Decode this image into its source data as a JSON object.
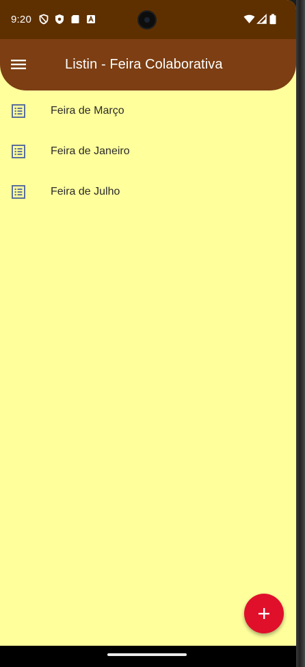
{
  "status_bar": {
    "time": "9:20",
    "left_icons": [
      "shield-outline-icon",
      "shield-filled-icon",
      "sd-card-icon",
      "text-box-icon"
    ],
    "right_icons": [
      "wifi-icon",
      "signal-icon",
      "battery-icon"
    ]
  },
  "app_bar": {
    "title": "Listin - Feira Colaborativa",
    "menu_icon": "hamburger-menu-icon",
    "background": "#7c3e12"
  },
  "lists": [
    {
      "label": "Feira de Março",
      "icon": "list-alt-icon"
    },
    {
      "label": "Feira de Janeiro",
      "icon": "list-alt-icon"
    },
    {
      "label": "Feira de Julho",
      "icon": "list-alt-icon"
    }
  ],
  "fab": {
    "icon": "plus-icon",
    "color": "#e0102b"
  },
  "colors": {
    "status_bar": "#5e3000",
    "background": "#ffff9c",
    "list_icon": "#5a6f9a"
  }
}
